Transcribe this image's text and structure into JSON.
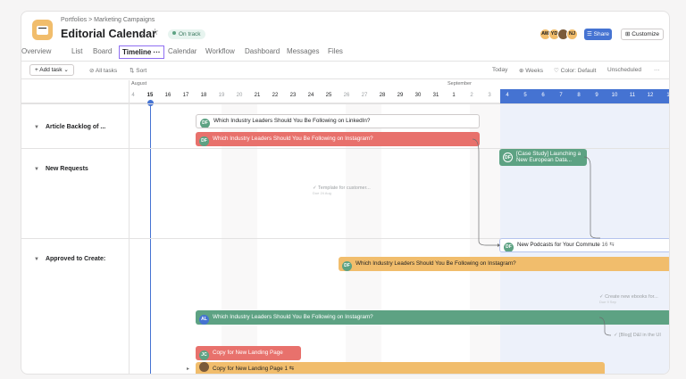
{
  "header": {
    "breadcrumb": "Portfolios  >  Marketing Campaigns",
    "title": "Editorial Calendar",
    "status": "On track",
    "avatars": [
      {
        "initials": "AW",
        "color": "#f1bd6c"
      },
      {
        "initials": "YD",
        "color": "#f1bd6c"
      },
      {
        "initials": "",
        "color": "#7a5a3a"
      },
      {
        "initials": "NJ",
        "color": "#f1bd6c"
      }
    ],
    "share_label": "Share",
    "customize_label": "Customize"
  },
  "tabs": [
    "Overview",
    "List",
    "Board",
    "Timeline",
    "Calendar",
    "Workflow",
    "Dashboard",
    "Messages",
    "Files"
  ],
  "active_tab_more": "···",
  "toolbar": {
    "add_task": "+ Add task",
    "all_tasks": "All tasks",
    "sort": "Sort",
    "today": "Today",
    "weeks": "Weeks",
    "color": "Color: Default",
    "unscheduled": "Unscheduled",
    "more": "···"
  },
  "months": {
    "august": "August",
    "september": "September"
  },
  "days": [
    "4",
    "15",
    "16",
    "17",
    "18",
    "19",
    "20",
    "21",
    "22",
    "23",
    "24",
    "25",
    "26",
    "27",
    "28",
    "29",
    "30",
    "31",
    "1",
    "2",
    "3",
    "4",
    "5",
    "6",
    "7",
    "8",
    "9",
    "10",
    "11",
    "12",
    "1"
  ],
  "sections": [
    {
      "title": "Article Backlog of ...",
      "caret": "▼"
    },
    {
      "title": "New Requests",
      "caret": "▼"
    },
    {
      "title": "Approved to Create:",
      "caret": "▼"
    }
  ],
  "tasks": [
    {
      "avatar": "DF",
      "avatar_color": "#5da283",
      "text": "Which Industry Leaders Should You Be Following on LinkedIn?"
    },
    {
      "avatar": "DF",
      "avatar_color": "#5da283",
      "text": "Which Industry Leaders Should You Be Following on Instagram?"
    },
    {
      "avatar": "DF",
      "avatar_color": "#5da283",
      "text": "[Case Study] Launching a New European Data..."
    },
    {
      "avatar": "DF",
      "avatar_color": "#5da283",
      "text": "New Podcasts for Your Commute",
      "suffix": "16 ⇆"
    },
    {
      "avatar": "DF",
      "avatar_color": "#5da283",
      "text": "Which Industry Leaders Should You Be Following on Instagram?"
    },
    {
      "avatar": "AL",
      "avatar_color": "#4573d2",
      "text": "Which Industry Leaders Should You Be Following on Instagram?"
    },
    {
      "avatar": "JC",
      "avatar_color": "#5da283",
      "text": "Copy for New Landing Page"
    },
    {
      "avatar": "",
      "avatar_color": "#7a5a3a",
      "text": "Copy for New Landing Page 1 ⇆"
    }
  ],
  "ghosts": [
    {
      "text": "✓ Template for customer...",
      "sub": "Due 24 Aug"
    },
    {
      "text": "✓ Create new ebooks for...",
      "sub": "Due 9 Sep"
    },
    {
      "text": "✓ [Blog] D&I in the UI"
    }
  ]
}
